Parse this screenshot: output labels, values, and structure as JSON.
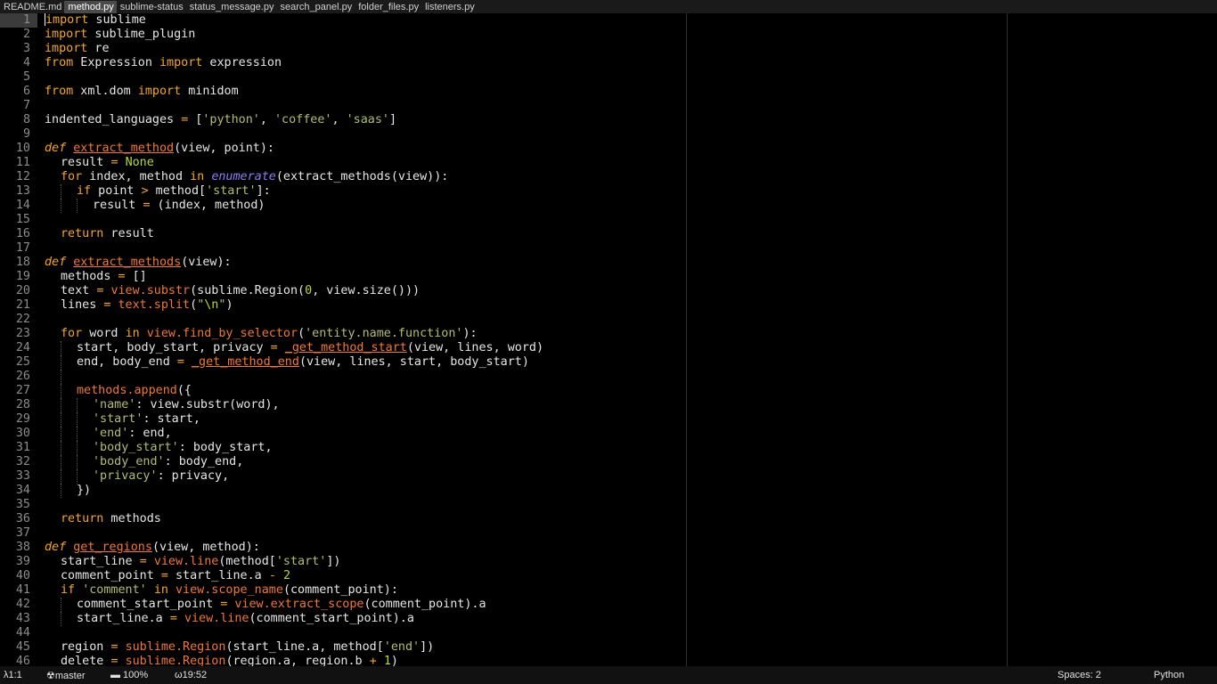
{
  "tabs": [
    "README.md",
    "method.py",
    "sublime-status",
    "status_message.py",
    "search_panel.py",
    "folder_files.py",
    "listeners.py"
  ],
  "active_tab": 1,
  "lines": [
    {
      "n": "1",
      "i": 0,
      "t": [
        [
          "kw",
          "import"
        ],
        [
          "pl",
          " sublime"
        ]
      ]
    },
    {
      "n": "2",
      "i": 0,
      "t": [
        [
          "kw",
          "import"
        ],
        [
          "pl",
          " sublime_plugin"
        ]
      ]
    },
    {
      "n": "3",
      "i": 0,
      "t": [
        [
          "kw",
          "import"
        ],
        [
          "pl",
          " re"
        ]
      ]
    },
    {
      "n": "4",
      "i": 0,
      "t": [
        [
          "kw",
          "from"
        ],
        [
          "pl",
          " Expression "
        ],
        [
          "kw",
          "import"
        ],
        [
          "pl",
          " expression"
        ]
      ]
    },
    {
      "n": "5",
      "i": 0,
      "t": []
    },
    {
      "n": "6",
      "i": 0,
      "t": [
        [
          "kw",
          "from"
        ],
        [
          "pl",
          " xml.dom "
        ],
        [
          "kw",
          "import"
        ],
        [
          "pl",
          " minidom"
        ]
      ]
    },
    {
      "n": "7",
      "i": 0,
      "t": []
    },
    {
      "n": "8",
      "i": 0,
      "t": [
        [
          "pl",
          "indented_languages "
        ],
        [
          "op",
          "="
        ],
        [
          "pl",
          " ["
        ],
        [
          "st",
          "'python'"
        ],
        [
          "pl",
          ", "
        ],
        [
          "st",
          "'coffee'"
        ],
        [
          "pl",
          ", "
        ],
        [
          "st",
          "'saas'"
        ],
        [
          "pl",
          "]"
        ]
      ]
    },
    {
      "n": "9",
      "i": 0,
      "t": []
    },
    {
      "n": "10",
      "i": 0,
      "t": [
        [
          "df",
          "def"
        ],
        [
          "pl",
          " "
        ],
        [
          "fn",
          "extract_method"
        ],
        [
          "pl",
          "(view, point):"
        ]
      ]
    },
    {
      "n": "11",
      "i": 1,
      "t": [
        [
          "pl",
          "result "
        ],
        [
          "op",
          "="
        ],
        [
          "pl",
          " "
        ],
        [
          "cn",
          "None"
        ]
      ]
    },
    {
      "n": "12",
      "i": 1,
      "t": [
        [
          "kw",
          "for"
        ],
        [
          "pl",
          " index, method "
        ],
        [
          "kw",
          "in"
        ],
        [
          "pl",
          " "
        ],
        [
          "bi",
          "enumerate"
        ],
        [
          "pl",
          "(extract_methods(view)):"
        ]
      ]
    },
    {
      "n": "13",
      "i": 2,
      "t": [
        [
          "kw",
          "if"
        ],
        [
          "pl",
          " point "
        ],
        [
          "op",
          ">"
        ],
        [
          "pl",
          " method["
        ],
        [
          "st",
          "'start'"
        ],
        [
          "pl",
          "]:"
        ]
      ]
    },
    {
      "n": "14",
      "i": 3,
      "t": [
        [
          "pl",
          "result "
        ],
        [
          "op",
          "="
        ],
        [
          "pl",
          " (index, method)"
        ]
      ]
    },
    {
      "n": "15",
      "i": 1,
      "t": []
    },
    {
      "n": "16",
      "i": 1,
      "t": [
        [
          "kw",
          "return"
        ],
        [
          "pl",
          " result"
        ]
      ]
    },
    {
      "n": "17",
      "i": 0,
      "t": []
    },
    {
      "n": "18",
      "i": 0,
      "t": [
        [
          "df",
          "def"
        ],
        [
          "pl",
          " "
        ],
        [
          "fn",
          "extract_methods"
        ],
        [
          "pl",
          "(view):"
        ]
      ]
    },
    {
      "n": "19",
      "i": 1,
      "t": [
        [
          "pl",
          "methods "
        ],
        [
          "op",
          "="
        ],
        [
          "pl",
          " []"
        ]
      ]
    },
    {
      "n": "20",
      "i": 1,
      "t": [
        [
          "pl",
          "text "
        ],
        [
          "op",
          "="
        ],
        [
          "pl",
          " "
        ],
        [
          "ca",
          "view.substr"
        ],
        [
          "pl",
          "(sublime.Region("
        ],
        [
          "nm",
          "0"
        ],
        [
          "pl",
          ", view.size()))"
        ]
      ]
    },
    {
      "n": "21",
      "i": 1,
      "t": [
        [
          "pl",
          "lines "
        ],
        [
          "op",
          "="
        ],
        [
          "pl",
          " "
        ],
        [
          "ca",
          "text.split"
        ],
        [
          "pl",
          "("
        ],
        [
          "st",
          "\""
        ],
        [
          "cn",
          "\\n"
        ],
        [
          "st",
          "\""
        ],
        [
          "pl",
          ")"
        ]
      ]
    },
    {
      "n": "22",
      "i": 1,
      "t": []
    },
    {
      "n": "23",
      "i": 1,
      "t": [
        [
          "kw",
          "for"
        ],
        [
          "pl",
          " word "
        ],
        [
          "kw",
          "in"
        ],
        [
          "pl",
          " "
        ],
        [
          "ca",
          "view.find_by_selector"
        ],
        [
          "pl",
          "("
        ],
        [
          "st",
          "'entity.name.function'"
        ],
        [
          "pl",
          "):"
        ]
      ]
    },
    {
      "n": "24",
      "i": 2,
      "t": [
        [
          "pl",
          "start, body_start, privacy "
        ],
        [
          "op",
          "="
        ],
        [
          "pl",
          " "
        ],
        [
          "fn",
          "_get_method_start"
        ],
        [
          "pl",
          "(view, lines, word)"
        ]
      ]
    },
    {
      "n": "25",
      "i": 2,
      "t": [
        [
          "pl",
          "end, body_end "
        ],
        [
          "op",
          "="
        ],
        [
          "pl",
          " "
        ],
        [
          "fn",
          "_get_method_end"
        ],
        [
          "pl",
          "(view, lines, start, body_start)"
        ]
      ]
    },
    {
      "n": "26",
      "i": 2,
      "t": []
    },
    {
      "n": "27",
      "i": 2,
      "t": [
        [
          "ca",
          "methods.append"
        ],
        [
          "pl",
          "({"
        ]
      ]
    },
    {
      "n": "28",
      "i": 3,
      "t": [
        [
          "st",
          "'name'"
        ],
        [
          "pl",
          ": view.substr(word),"
        ]
      ]
    },
    {
      "n": "29",
      "i": 3,
      "t": [
        [
          "st",
          "'start'"
        ],
        [
          "pl",
          ": start,"
        ]
      ]
    },
    {
      "n": "30",
      "i": 3,
      "t": [
        [
          "st",
          "'end'"
        ],
        [
          "pl",
          ": end,"
        ]
      ]
    },
    {
      "n": "31",
      "i": 3,
      "t": [
        [
          "st",
          "'body_start'"
        ],
        [
          "pl",
          ": body_start,"
        ]
      ]
    },
    {
      "n": "32",
      "i": 3,
      "t": [
        [
          "st",
          "'body_end'"
        ],
        [
          "pl",
          ": body_end,"
        ]
      ]
    },
    {
      "n": "33",
      "i": 3,
      "t": [
        [
          "st",
          "'privacy'"
        ],
        [
          "pl",
          ": privacy,"
        ]
      ]
    },
    {
      "n": "34",
      "i": 2,
      "t": [
        [
          "pl",
          "})"
        ]
      ]
    },
    {
      "n": "35",
      "i": 1,
      "t": []
    },
    {
      "n": "36",
      "i": 1,
      "t": [
        [
          "kw",
          "return"
        ],
        [
          "pl",
          " methods"
        ]
      ]
    },
    {
      "n": "37",
      "i": 0,
      "t": []
    },
    {
      "n": "38",
      "i": 0,
      "t": [
        [
          "df",
          "def"
        ],
        [
          "pl",
          " "
        ],
        [
          "fn",
          "get_regions"
        ],
        [
          "pl",
          "(view, method):"
        ]
      ]
    },
    {
      "n": "39",
      "i": 1,
      "t": [
        [
          "pl",
          "start_line "
        ],
        [
          "op",
          "="
        ],
        [
          "pl",
          " "
        ],
        [
          "ca",
          "view.line"
        ],
        [
          "pl",
          "(method["
        ],
        [
          "st",
          "'start'"
        ],
        [
          "pl",
          "])"
        ]
      ]
    },
    {
      "n": "40",
      "i": 1,
      "t": [
        [
          "pl",
          "comment_point "
        ],
        [
          "op",
          "="
        ],
        [
          "pl",
          " start_line.a "
        ],
        [
          "op",
          "-"
        ],
        [
          "pl",
          " "
        ],
        [
          "nm",
          "2"
        ]
      ]
    },
    {
      "n": "41",
      "i": 1,
      "t": [
        [
          "kw",
          "if"
        ],
        [
          "pl",
          " "
        ],
        [
          "st",
          "'comment'"
        ],
        [
          "pl",
          " "
        ],
        [
          "kw",
          "in"
        ],
        [
          "pl",
          " "
        ],
        [
          "ca",
          "view.scope_name"
        ],
        [
          "pl",
          "(comment_point):"
        ]
      ]
    },
    {
      "n": "42",
      "i": 2,
      "t": [
        [
          "pl",
          "comment_start_point "
        ],
        [
          "op",
          "="
        ],
        [
          "pl",
          " "
        ],
        [
          "ca",
          "view.extract_scope"
        ],
        [
          "pl",
          "(comment_point).a"
        ]
      ]
    },
    {
      "n": "43",
      "i": 2,
      "t": [
        [
          "pl",
          "start_line.a "
        ],
        [
          "op",
          "="
        ],
        [
          "pl",
          " "
        ],
        [
          "ca",
          "view.line"
        ],
        [
          "pl",
          "(comment_start_point).a"
        ]
      ]
    },
    {
      "n": "44",
      "i": 1,
      "t": []
    },
    {
      "n": "45",
      "i": 1,
      "t": [
        [
          "pl",
          "region "
        ],
        [
          "op",
          "="
        ],
        [
          "pl",
          " "
        ],
        [
          "ca",
          "sublime.Region"
        ],
        [
          "pl",
          "(start_line.a, method["
        ],
        [
          "st",
          "'end'"
        ],
        [
          "pl",
          "])"
        ]
      ]
    },
    {
      "n": "46",
      "i": 1,
      "t": [
        [
          "pl",
          "delete "
        ],
        [
          "op",
          "="
        ],
        [
          "pl",
          " "
        ],
        [
          "ca",
          "sublime.Region"
        ],
        [
          "pl",
          "(region.a, region.b "
        ],
        [
          "op",
          "+"
        ],
        [
          "pl",
          " "
        ],
        [
          "nm",
          "1"
        ],
        [
          "pl",
          ")"
        ]
      ]
    }
  ],
  "status": {
    "position": "λ1:1",
    "branch": "☢master",
    "battery": "▬ 100%",
    "clock": "ω19:52",
    "spaces": "Spaces: 2",
    "syntax": "Python"
  },
  "colors": {
    "keyword": "#f5a623",
    "string": "#b5bd68",
    "function": "#f07830",
    "builtin": "#8b7cf6",
    "constant": "#b5d93a"
  }
}
